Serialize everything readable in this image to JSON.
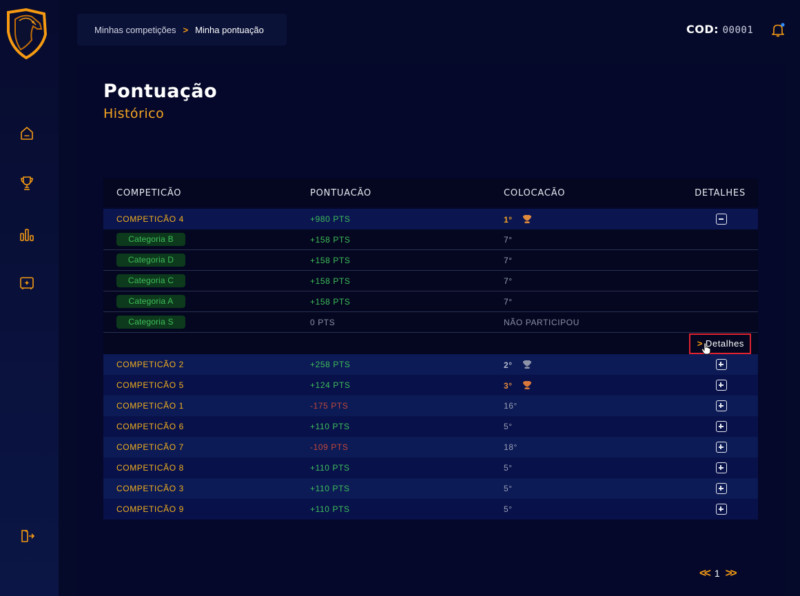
{
  "breadcrumb": {
    "parent": "Minhas competições",
    "current": "Minha pontuação"
  },
  "header": {
    "cod_label": "COD:",
    "cod_value": "00001"
  },
  "page": {
    "title": "Pontuação",
    "subtitle": "Histórico"
  },
  "table": {
    "columns": [
      "COMPETICÃO",
      "PONTUACÃO",
      "COLOCACÃO",
      "DETALHES"
    ],
    "expanded": {
      "name": "COMPETICÃO 4",
      "points": "+980 PTS",
      "place": "1°",
      "categories": [
        {
          "name": "Categoria B",
          "points": "+158 PTS",
          "place": "7°"
        },
        {
          "name": "Categoria D",
          "points": "+158 PTS",
          "place": "7°"
        },
        {
          "name": "Categoria C",
          "points": "+158 PTS",
          "place": "7°"
        },
        {
          "name": "Categoria A",
          "points": "+158 PTS",
          "place": "7°"
        },
        {
          "name": "Categoria S",
          "points": "0 PTS",
          "place": "NÃO PARTICIPOU"
        }
      ],
      "details_label": "Detalhes"
    },
    "rows": [
      {
        "name": "COMPETICÃO 2",
        "points": "+258 PTS",
        "place": "2°"
      },
      {
        "name": "COMPETICÃO 5",
        "points": "+124 PTS",
        "place": "3°"
      },
      {
        "name": "COMPETICÃO 1",
        "points": "-175 PTS",
        "place": "16°"
      },
      {
        "name": "COMPETICÃO 6",
        "points": "+110 PTS",
        "place": "5°"
      },
      {
        "name": "COMPETICÃO 7",
        "points": "-109 PTS",
        "place": "18°"
      },
      {
        "name": "COMPETICÃO 8",
        "points": "+110 PTS",
        "place": "5°"
      },
      {
        "name": "COMPETICÃO 3",
        "points": "+110 PTS",
        "place": "5°"
      },
      {
        "name": "COMPETICÃO 9",
        "points": "+110 PTS",
        "place": "5°"
      }
    ]
  },
  "pagination": {
    "current": "1"
  },
  "colors": {
    "accent": "#f59a12",
    "positive": "#3fbf5a",
    "negative": "#c2493e",
    "highlight": "#e0232f"
  },
  "icons": [
    "horse-logo-icon",
    "home-icon",
    "trophy-icon",
    "chart-icon",
    "ticket-icon",
    "logout-icon",
    "bell-icon"
  ]
}
